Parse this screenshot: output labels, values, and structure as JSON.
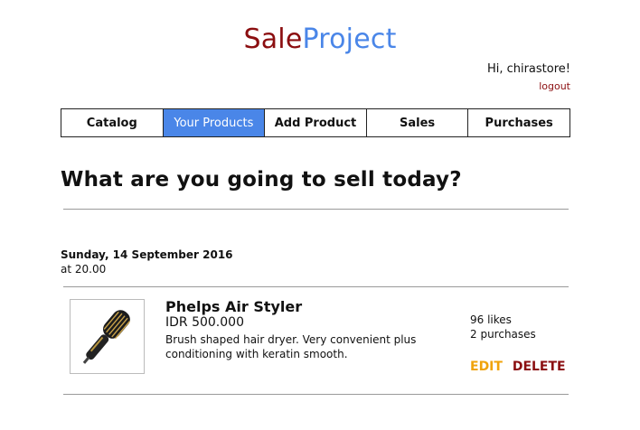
{
  "brand": {
    "part1": "Sale",
    "part2": "Project"
  },
  "user": {
    "greeting": "Hi, chirastore!",
    "logout_label": "logout"
  },
  "nav": {
    "tabs": [
      {
        "label": "Catalog"
      },
      {
        "label": "Your Products"
      },
      {
        "label": "Add Product"
      },
      {
        "label": "Sales"
      },
      {
        "label": "Purchases"
      }
    ],
    "active_index": 1
  },
  "main": {
    "headline": "What are you going to sell today?",
    "entry": {
      "date": "Sunday, 14 September 2016",
      "time": "at 20.00",
      "product": {
        "image_icon": "hair-dryer-brush-icon",
        "name": "Phelps Air Styler",
        "price": "IDR 500.000",
        "description": "Brush shaped hair dryer. Very convenient plus conditioning with keratin smooth.",
        "likes": "96 likes",
        "purchases": "2 purchases",
        "edit_label": "EDIT",
        "delete_label": "DELETE"
      }
    }
  },
  "colors": {
    "brand_red": "#8b0e10",
    "brand_blue": "#4a86e8",
    "edit_orange": "#f0a30a"
  }
}
